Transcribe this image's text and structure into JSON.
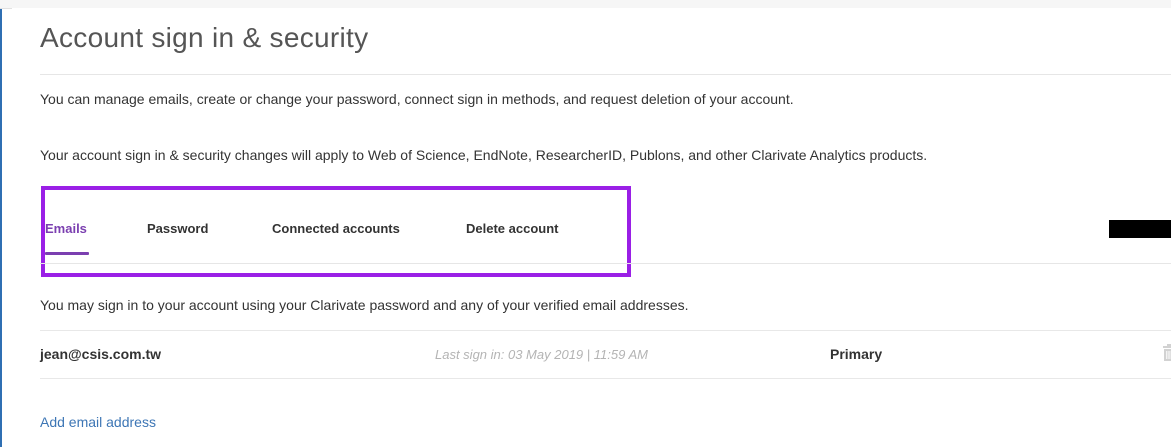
{
  "page": {
    "title": "Account sign in & security",
    "description_1": "You can manage emails, create or change your password, connect sign in methods, and request deletion of your account.",
    "description_2": "Your account sign in & security changes will apply to Web of Science, EndNote, ResearcherID, Publons, and other Clarivate Analytics products."
  },
  "tabs": [
    {
      "label": "Emails",
      "active": true
    },
    {
      "label": "Password",
      "active": false
    },
    {
      "label": "Connected accounts",
      "active": false
    },
    {
      "label": "Delete account",
      "active": false
    }
  ],
  "emails_section": {
    "info": "You may sign in to your account using your Clarivate password and any of your verified email addresses.",
    "rows": [
      {
        "email": "jean@csis.com.tw",
        "last_sign_in": "Last sign in: 03 May 2019 | 11:59 AM",
        "status": "Primary",
        "action_icon": "trash-icon"
      }
    ],
    "add_link": "Add email address"
  },
  "colors": {
    "accent": "#7b3fb0",
    "highlight_box": "#9a1fe6",
    "link": "#3d76b5",
    "frame_border": "#2f6fb3"
  }
}
